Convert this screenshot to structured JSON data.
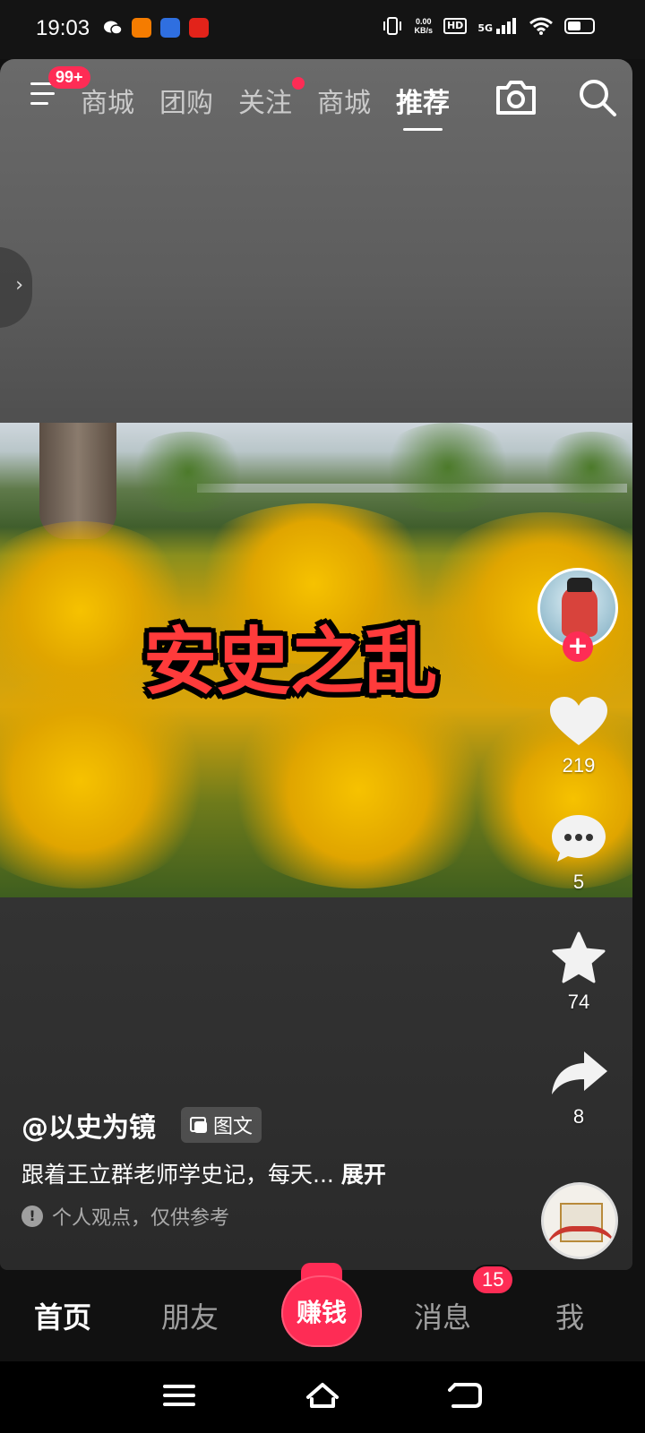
{
  "status_bar": {
    "time": "19:03",
    "net_speed": "0.00",
    "net_unit": "KB/s",
    "hd_label": "HD",
    "signal_label": "5G",
    "battery_level": 0.45,
    "app_icons": [
      "wechat-icon",
      "taobao-icon",
      "baidu-icon",
      "news-icon"
    ]
  },
  "top_nav": {
    "menu_badge": "99+",
    "tabs": [
      {
        "label": "商城",
        "active": false
      },
      {
        "label": "团购",
        "active": false
      },
      {
        "label": "关注",
        "active": false,
        "dot": true
      },
      {
        "label": "商城",
        "active": false
      },
      {
        "label": "推荐",
        "active": true
      }
    ]
  },
  "post": {
    "image_title": "安史之乱",
    "author": "@以史为镜",
    "type_chip": "图文",
    "description": "跟着王立群老师学史记，每天...",
    "expand_label": "展开",
    "disclaimer": "个人观点，仅供参考"
  },
  "actions": {
    "follow_plus": "+",
    "likes": "219",
    "comments": "5",
    "favorites": "74",
    "shares": "8"
  },
  "bottom_nav": {
    "home": "首页",
    "friends": "朋友",
    "earn": "赚钱",
    "messages": "消息",
    "messages_badge": "15",
    "me": "我"
  },
  "colors": {
    "accent": "#fe2c55",
    "title_text": "#ff3b3b"
  }
}
